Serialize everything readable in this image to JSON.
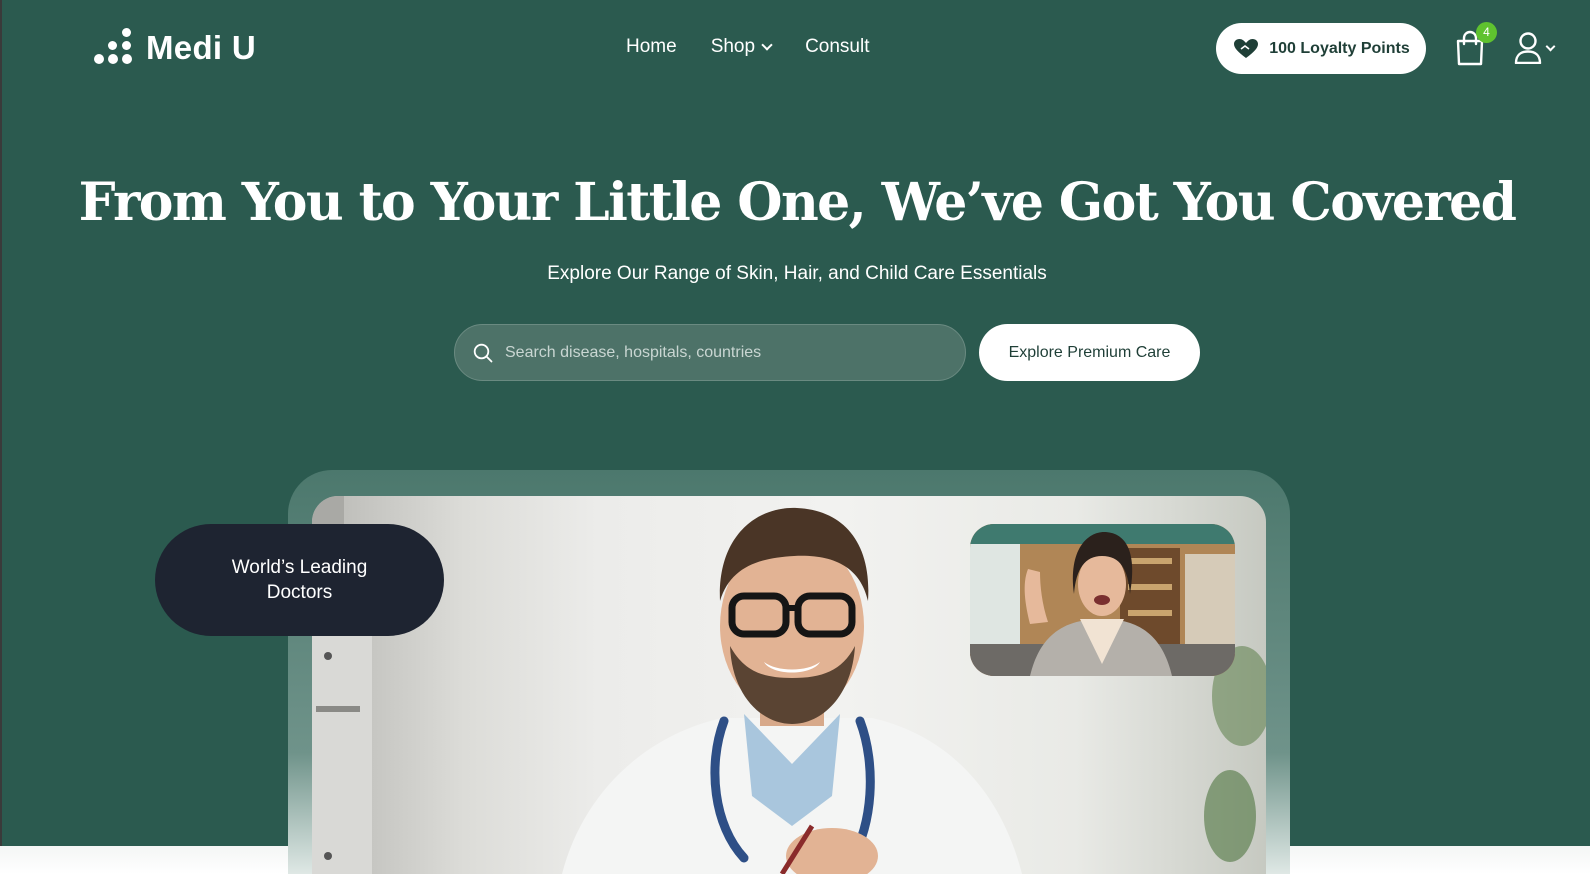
{
  "brand": {
    "name": "Medi U"
  },
  "nav": {
    "home": "Home",
    "shop": "Shop",
    "consult": "Consult"
  },
  "header": {
    "loyalty_label": "100 Loyalty Points",
    "cart_count": "4"
  },
  "hero": {
    "headline": "From You to Your Little One, We’ve Got You Covered",
    "subhead": "Explore Our Range of Skin, Hair, and Child Care Essentials",
    "search_placeholder": "Search disease, hospitals, countries",
    "cta_label": "Explore Premium Care",
    "badge_text": "World’s Leading Doctors"
  },
  "colors": {
    "hero_bg": "#2b5a4f",
    "badge_bg": "#1e2431",
    "cart_badge": "#5fc22f",
    "button_text": "#1f3f37"
  },
  "icons": [
    "logo-dots-icon",
    "chevron-down-icon",
    "heart-hands-icon",
    "shopping-bag-icon",
    "user-icon",
    "search-icon"
  ]
}
